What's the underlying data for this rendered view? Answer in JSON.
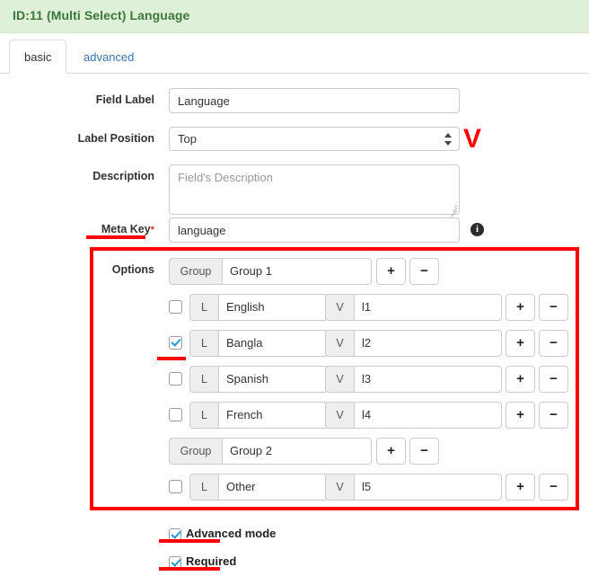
{
  "header": {
    "title": "ID:11 (Multi Select) Language",
    "bg_color": "#dff0d8",
    "text_color": "#3c763d"
  },
  "tabs": [
    {
      "label": "basic",
      "active": true
    },
    {
      "label": "advanced",
      "active": false
    }
  ],
  "form": {
    "field_label": {
      "label": "Field Label",
      "value": "Language"
    },
    "label_position": {
      "label": "Label Position",
      "value": "Top"
    },
    "description": {
      "label": "Description",
      "placeholder": "Field's Description",
      "value": ""
    },
    "meta_key": {
      "label": "Meta Key",
      "required_marker": "*",
      "value": "language",
      "info_icon_glyph": "i"
    }
  },
  "options": {
    "label": "Options",
    "group_addon_label": "Group",
    "label_addon": "L",
    "value_addon": "V",
    "add_button_label": "+",
    "remove_button_label": "−",
    "rows": [
      {
        "type": "group",
        "value": "Group 1"
      },
      {
        "type": "option",
        "checked": false,
        "label": "English",
        "value": "l1"
      },
      {
        "type": "option",
        "checked": true,
        "label": "Bangla",
        "value": "l2"
      },
      {
        "type": "option",
        "checked": false,
        "label": "Spanish",
        "value": "l3"
      },
      {
        "type": "option",
        "checked": false,
        "label": "French",
        "value": "l4"
      },
      {
        "type": "group",
        "value": "Group 2"
      },
      {
        "type": "option",
        "checked": false,
        "label": "Other",
        "value": "l5"
      }
    ]
  },
  "footer_checks": [
    {
      "label": "Advanced mode",
      "checked": true
    },
    {
      "label": "Required",
      "checked": true
    }
  ],
  "annotations": {
    "color": "#ff0000",
    "v_mark": "V"
  }
}
